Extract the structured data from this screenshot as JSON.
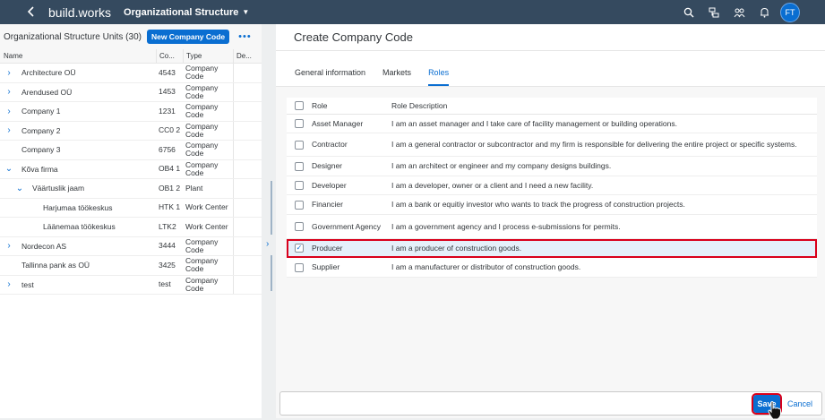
{
  "shell": {
    "back_icon": "chevron-left-icon",
    "brand": "build.works",
    "app_title": "Organizational Structure",
    "actions": [
      "search-icon",
      "org-chart-icon",
      "people-icon",
      "bell-icon"
    ],
    "avatar_initials": "FT"
  },
  "left": {
    "title": "Organizational Structure Units (30)",
    "new_button": "New Company Code",
    "more": "•••",
    "columns": {
      "name": "Name",
      "code": "Co...",
      "type": "Type",
      "desc": "De..."
    },
    "rows": [
      {
        "name": "Architecture OÜ",
        "code": "4543",
        "type": "Company Code",
        "chevron": "right",
        "indent": 0
      },
      {
        "name": "Arendused OÜ",
        "code": "1453",
        "type": "Company Code",
        "chevron": "right",
        "indent": 0
      },
      {
        "name": "Company 1",
        "code": "1231",
        "type": "Company Code",
        "chevron": "right",
        "indent": 0
      },
      {
        "name": "Company 2",
        "code": "CC0 2",
        "type": "Company Code",
        "chevron": "right",
        "indent": 0
      },
      {
        "name": "Company 3",
        "code": "6756",
        "type": "Company Code",
        "chevron": "none",
        "indent": 0
      },
      {
        "name": "Kõva firma",
        "code": "OB4 1",
        "type": "Company Code",
        "chevron": "down",
        "indent": 0
      },
      {
        "name": "Väärtuslik jaam",
        "code": "OB1 2",
        "type": "Plant",
        "chevron": "down",
        "indent": 1
      },
      {
        "name": "Harjumaa töökeskus",
        "code": "HTK 1",
        "type": "Work Center",
        "chevron": "none",
        "indent": 2
      },
      {
        "name": "Läänemaa töökeskus",
        "code": "LTK2",
        "type": "Work Center",
        "chevron": "none",
        "indent": 2
      },
      {
        "name": "Nordecon AS",
        "code": "3444",
        "type": "Company Code",
        "chevron": "right",
        "indent": 0
      },
      {
        "name": "Tallinna pank as OÜ",
        "code": "3425",
        "type": "Company Code",
        "chevron": "none",
        "indent": 0
      },
      {
        "name": "test",
        "code": "test",
        "type": "Company Code",
        "chevron": "right",
        "indent": 0
      }
    ]
  },
  "right": {
    "title": "Create Company Code",
    "tabs": [
      {
        "label": "General information",
        "active": false
      },
      {
        "label": "Markets",
        "active": false
      },
      {
        "label": "Roles",
        "active": true
      }
    ],
    "table": {
      "header": {
        "role": "Role",
        "desc": "Role Description"
      },
      "rows": [
        {
          "role": "Asset Manager",
          "desc": "I am an asset manager and I take care of facility management or building operations.",
          "checked": false
        },
        {
          "role": "Contractor",
          "desc": "I am a general contractor or subcontractor and my firm is responsible for delivering the entire project or specific systems.",
          "checked": false
        },
        {
          "role": "Designer",
          "desc": "I am an architect or engineer and my company designs buildings.",
          "checked": false
        },
        {
          "role": "Developer",
          "desc": "I am a developer, owner or a client and I need a new facility.",
          "checked": false
        },
        {
          "role": "Financier",
          "desc": "I am a bank or equitiy investor who wants to track the progress of construction projects.",
          "checked": false
        },
        {
          "role": "Government Agency",
          "desc": "I am a government agency and I process e-submissions for permits.",
          "checked": false
        },
        {
          "role": "Producer",
          "desc": "I am a producer of construction goods.",
          "checked": true
        },
        {
          "role": "Supplier",
          "desc": "I am a manufacturer or distributor of construction goods.",
          "checked": false
        }
      ]
    },
    "footer": {
      "save": "Save",
      "cancel": "Cancel"
    }
  },
  "colors": {
    "shell": "#354a5f",
    "accent": "#0a6ed1",
    "highlight": "#d9001b"
  }
}
